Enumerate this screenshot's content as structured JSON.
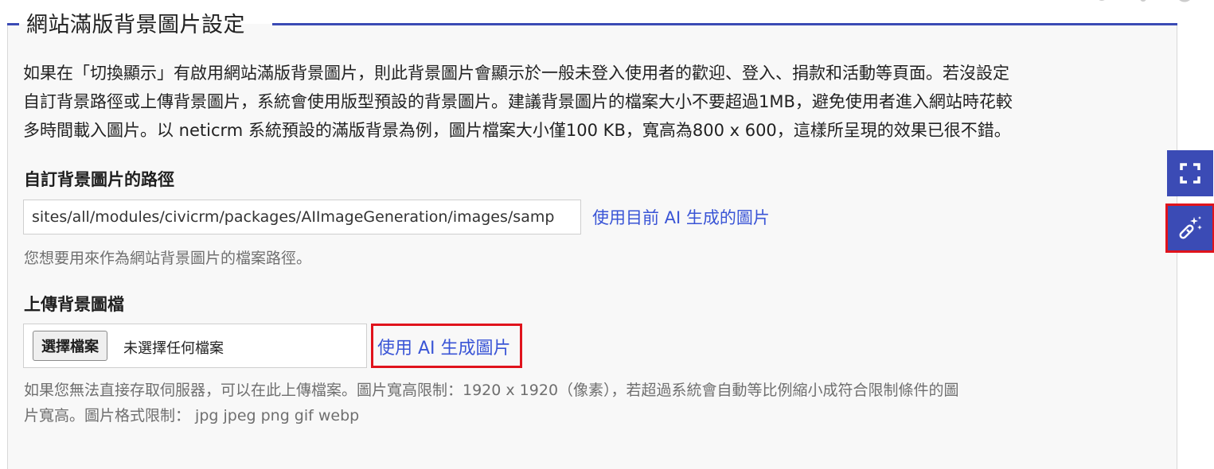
{
  "fieldset": {
    "legend": "網站滿版背景圖片設定",
    "accent_color": "#3b4bb5"
  },
  "description": {
    "lines": [
      "如果在「切換顯示」有啟用網站滿版背景圖片，則此背景圖片會顯示於一般未登入使用者的歡迎、登入、捐款和活動等頁面。若沒設定",
      "自訂背景路徑或上傳背景圖片，系統會使用版型預設的背景圖片。建議背景圖片的檔案大小不要超過1MB，避免使用者進入網站時花較",
      "多時間載入圖片。以 neticrm 系統預設的滿版背景為例，圖片檔案大小僅100 KB，寬高為800 x 600，這樣所呈現的效果已很不錯。"
    ]
  },
  "path_field": {
    "label": "自訂背景圖片的路徑",
    "value": "sites/all/modules/civicrm/packages/AIImageGeneration/images/samp",
    "use_current_ai_link": "使用目前 AI 生成的圖片",
    "help": "您想要用來作為網站背景圖片的檔案路徑。"
  },
  "upload_field": {
    "label": "上傳背景圖檔",
    "choose_button": "選擇檔案",
    "file_status": "未選擇任何檔案",
    "use_ai_link": "使用 AI 生成圖片",
    "help_lines": [
      "如果您無法直接存取伺服器，可以在此上傳檔案。圖片寬高限制：1920 x 1920（像素），若超過系統會自動等比例縮小成符合限制條件的圖",
      "片寬高。圖片格式限制： jpg jpeg png gif webp"
    ]
  },
  "side_buttons": [
    {
      "icon": "fullscreen-icon"
    },
    {
      "icon": "magic-wand-icon"
    }
  ],
  "colors": {
    "link": "#3a55d6",
    "highlight": "#e0131c",
    "side_button_bg": "#3b4bb5"
  }
}
